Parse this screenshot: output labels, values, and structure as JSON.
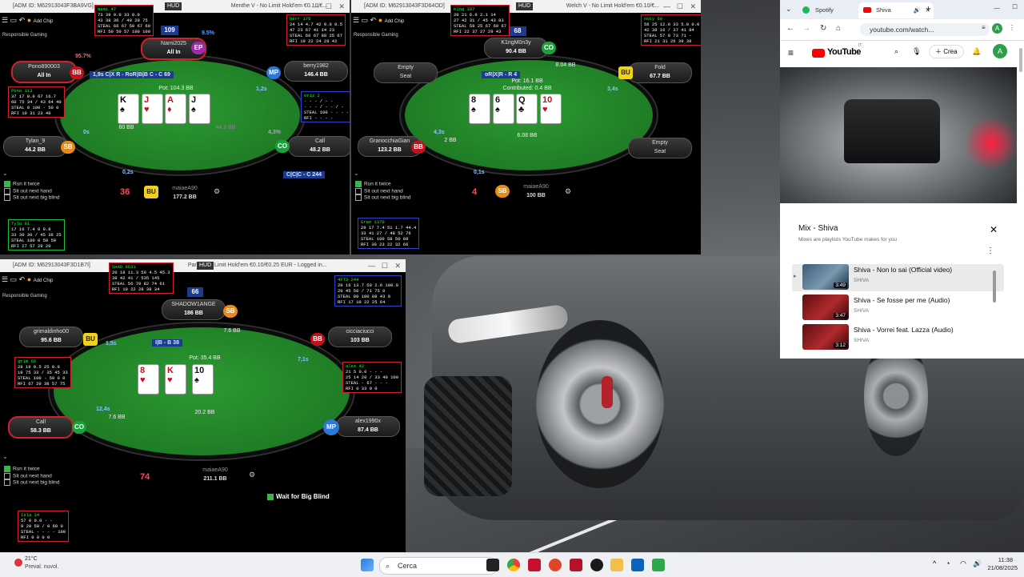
{
  "desktop": {
    "wallpaper": "car-on-road"
  },
  "tables": [
    {
      "title": "[ADM ID: M62913043F3BA9VG]",
      "title2": "Menthe V - No Limit Hold'em €0.10/€...",
      "hud_tag": "HUD",
      "tool_label": "Add Chip",
      "responsible": "Responsible Gaming",
      "hand_number": "36",
      "pot": "Pot: 104.3 BB",
      "action_tag": "1,9s C|X R - RoR|B|B C - C 69",
      "cards": [
        {
          "r": "K",
          "s": "♠",
          "c": "b"
        },
        {
          "r": "J",
          "s": "♥",
          "c": "r"
        },
        {
          "r": "A",
          "s": "♦",
          "c": "r"
        },
        {
          "r": "J",
          "s": "♠",
          "c": "b"
        }
      ],
      "seats": [
        {
          "name": "Nami2025",
          "stack": "All In",
          "badge": "EP"
        },
        {
          "name": "berry1982",
          "stack": "146.4 BB",
          "badge": "MP"
        },
        {
          "name": "Pono890003",
          "stack": "All In",
          "badge": "BB"
        },
        {
          "name": "Tylan_9",
          "stack": "44.2 BB",
          "badge": "SB"
        },
        {
          "name": "",
          "stack": "48.2 BB",
          "badge": "CO",
          "action": "Call"
        },
        {
          "name": "maiaeA90",
          "stack": "177.2 BB",
          "badge": "BU"
        }
      ],
      "nami_score": "109",
      "co_tag": "C|C|C - C 244",
      "timers": [
        "1,2s",
        "0s",
        "0,2s",
        "4,3%",
        "95.7%",
        "9.5%"
      ],
      "bet_chips": [
        "60 BB",
        "44.2 BB"
      ],
      "options": [
        "Run it twice",
        "Sit out next hand",
        "Sit out next big blind"
      ],
      "huds": [
        {
          "name": "Nami 47",
          "line": "73 39 0.0 33 0.0\n43 38 36 / 40 29 75\nSTEAL 66 67 50 67 60\nRFI 50 50 57 100 100"
        },
        {
          "name": "berr 176",
          "line": "24 14 4.7 42 0.0 0.5\n47 23 67 41 14 23\nSTEAL 66 67 88 25 67\nRFI 19 22 24 28 42"
        },
        {
          "name": "Pono 113",
          "line": "37 17 0.0 67 16.7\n60 75 34 / 43 64 40\nSTEAL 0 100 - 50 0\nRFI 19 31 23 40"
        },
        {
          "name": "oriz 2",
          "line": "- - - / - -\n- - - / - - / -\nSTEAL 100 - - - -\nRFI - - - -"
        },
        {
          "name": "Tylu 91",
          "line": "17 16 7.4 0 9.8\n33 30 30 / 45 36 25\nSTEAL 100 0 50 50\nRFI 27 57 29 20"
        }
      ]
    },
    {
      "title": "[ADM ID: M62913043F3D64OD]",
      "title2": "Welch V - No Limit Hold'em €0.10/€...",
      "hud_tag": "HUD",
      "tool_label": "Add Chip",
      "responsible": "Responsible Gaming",
      "hand_number": "4",
      "pot": "Pot: 16.1 BB",
      "contributed": "Contributed: 0.4 BB",
      "action_tag": "oR|X|R - R 4",
      "cards": [
        {
          "r": "8",
          "s": "♠",
          "c": "b"
        },
        {
          "r": "6",
          "s": "♠",
          "c": "b"
        },
        {
          "r": "Q",
          "s": "♣",
          "c": "b"
        },
        {
          "r": "10",
          "s": "♥",
          "c": "r"
        }
      ],
      "seats": [
        {
          "name": "K1ngM0n3y",
          "stack": "90.4 BB",
          "badge": "CO"
        },
        {
          "name": "Fold",
          "stack": "67.7 BB",
          "badge": "BU"
        },
        {
          "name": "Empty",
          "stack": "Seat",
          "badge": ""
        },
        {
          "name": "Empty",
          "stack": "Seat",
          "badge": ""
        },
        {
          "name": "GranocchiaGian",
          "stack": "123.2 BB",
          "badge": "BB"
        },
        {
          "name": "maiaeA90",
          "stack": "100 BB",
          "badge": "SB"
        }
      ],
      "k1ng_score": "68",
      "side_bets": [
        "8.04 BB",
        "2 BB",
        "6.08 BB"
      ],
      "timers": [
        "3,4s",
        "4,3s",
        "0,1s"
      ],
      "options": [
        "Run it twice",
        "Sit out next hand",
        "Sit out next big blind"
      ],
      "huds": [
        {
          "name": "K1ng 197",
          "line": "20 21 6.0 2.1 14\n27 42 31 / 45 43 83\nSTEAL 58 25 67 60 67\nRFI 22 37 27 29 43"
        },
        {
          "name": "noty 69",
          "line": "56 25 12.6 33 5.0 0.0\n42 38 16 / 37 41 84\nSTEAL 57 0 73 71 -\nRFI 21 31 26 39 38"
        },
        {
          "name": "Gran 1370",
          "line": "29 17 7.4 51 1.7 44.4\n33 41 27 / 48 52 76\nSTEAL 100 58 50 88\nRFI 30 23 22 32 66"
        }
      ]
    },
    {
      "title": "[ADM ID: M62913043F3D1B7I]",
      "title2": "Paris - No Limit Hold'em €0.10/€0.25 EUR - Logged in...",
      "hud_tag": "HUD",
      "tool_label": "Add Chip",
      "responsible": "Responsible Gaming",
      "hand_number": "74",
      "pot": "Pot: 35.4 BB",
      "action_tag": "I|B - B 38",
      "cards": [
        {
          "r": "8",
          "s": "♥",
          "c": "r"
        },
        {
          "r": "K",
          "s": "♥",
          "c": "r"
        },
        {
          "r": "10",
          "s": "♠",
          "c": "b"
        }
      ],
      "seats": [
        {
          "name": "SHADOW1ANGE",
          "stack": "186 BB",
          "badge": "SB"
        },
        {
          "name": "grimaldinho00",
          "stack": "95.6 BB",
          "badge": "BU"
        },
        {
          "name": "cicciaciucci",
          "stack": "103 BB",
          "badge": "BB"
        },
        {
          "name": "Call",
          "stack": "58.3 BB",
          "badge": "CO"
        },
        {
          "name": "alex1990x",
          "stack": "87.4 BB",
          "badge": "MP"
        },
        {
          "name": "maiaeA90",
          "stack": "211.1 BB",
          "badge": ""
        }
      ],
      "shad_score": "66",
      "side_bets": [
        "7.6 BB",
        "7.6 BB",
        "20.2 BB"
      ],
      "timers": [
        "1,5s",
        "7,1s",
        "12,4s"
      ],
      "options": [
        "Run it twice",
        "Sit out next hand",
        "Sit out next big blind"
      ],
      "wait_bb": "Wait for Big Blind",
      "huds": [
        {
          "name": "SHAD 8631",
          "line": "20 18 11.3 50 4.5 45.3\n39 42 41 / 535 145\nSTEAL 56 70 82 74 61\nRFI 19 22 28 38 34"
        },
        {
          "name": "4FT3 244",
          "line": "20 16 13.7 50 2.6 100.0\n20 45 50 / 71 75 0\nSTEAL 80 100 88 43 0\nRFI 17 10 22 25 64"
        },
        {
          "name": "grim 66",
          "line": "29 19 9.5 25 0.0\n19 75 33 / 35 45 33\nSTEAL 100 - 50 0 0\nRFI 67 20 38 57 75"
        },
        {
          "name": "alex 42",
          "line": "21 5 0.0 - - -\n25 14 20 / 33 40 100\nSTEAL - 67 - - -\nRFI 0 33 0 0"
        },
        {
          "name": "Isla 14",
          "line": "57 0 0.0 - -\n0 20 50 / 0 60 0\nSTEAL - - - - 100\nRFI 0 0 0 0"
        }
      ]
    }
  ],
  "browser": {
    "tabs": [
      {
        "label": "Spotify"
      },
      {
        "label": "Shiva"
      }
    ],
    "new_tab": "+",
    "url": "youtube.com/watch...",
    "brand": "YouTube",
    "brand_sup": "IT",
    "create_label": "Crea",
    "avatar_letter": "A",
    "mix_title": "Mix - Shiva",
    "mix_subtitle": "Mixes are playlists YouTube makes for you",
    "items": [
      {
        "title": "Shiva - Non lo sai (Official video)",
        "channel": "SHIVA",
        "duration": "3:49"
      },
      {
        "title": "Shiva - Se fosse per me (Audio)",
        "channel": "SHIVA",
        "duration": "3:47"
      },
      {
        "title": "Shiva - Vorrei feat. Lazza (Audio)",
        "channel": "SHIVA",
        "duration": "3:12"
      }
    ]
  },
  "taskbar": {
    "weather_temp": "21°C",
    "weather_desc": "Preval. nuvol.",
    "search_label": "Cerca",
    "time": "11:38",
    "date": "21/08/2025"
  }
}
